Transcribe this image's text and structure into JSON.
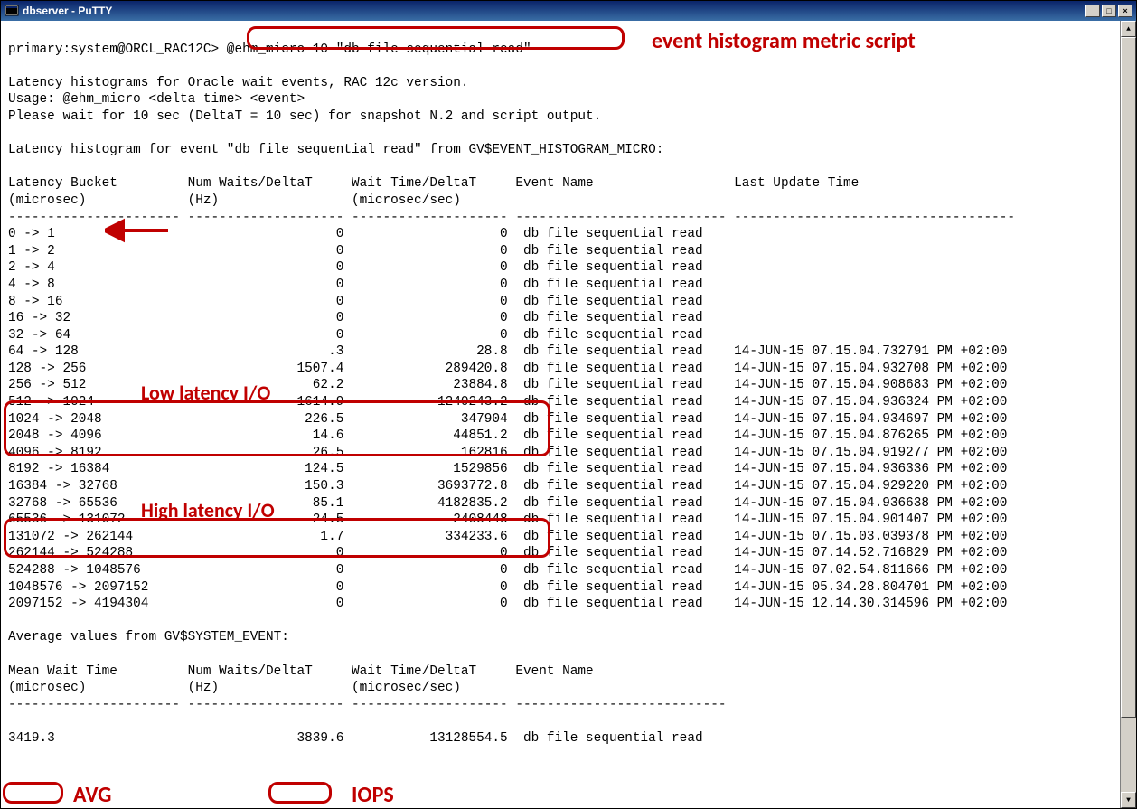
{
  "window": {
    "title": "dbserver - PuTTY",
    "icon_name": "terminal-icon"
  },
  "prompt": {
    "text": "primary:system@ORCL_RAC12C>",
    "command": "@ehm_micro 10 \"db file sequential read\""
  },
  "intro": {
    "line1": "Latency histograms for Oracle wait events, RAC 12c version.",
    "line2": "Usage: @ehm_micro <delta time> <event>",
    "line3": "Please wait for 10 sec (DeltaT = 10 sec) for snapshot N.2 and script output.",
    "line4": "Latency histogram for event \"db file sequential read\" from GV$EVENT_HISTOGRAM_MICRO:"
  },
  "columns": {
    "c1a": "Latency Bucket",
    "c1b": "(microsec)",
    "c2a": "Num Waits/DeltaT",
    "c2b": "(Hz)",
    "c3a": "Wait Time/DeltaT",
    "c3b": "(microsec/sec)",
    "c4": "Event Name",
    "c5": "Last Update Time"
  },
  "rows": [
    {
      "bucket": "0 -> 1",
      "waits": "0",
      "wt": "0",
      "evt": "db file sequential read",
      "ts": ""
    },
    {
      "bucket": "1 -> 2",
      "waits": "0",
      "wt": "0",
      "evt": "db file sequential read",
      "ts": ""
    },
    {
      "bucket": "2 -> 4",
      "waits": "0",
      "wt": "0",
      "evt": "db file sequential read",
      "ts": ""
    },
    {
      "bucket": "4 -> 8",
      "waits": "0",
      "wt": "0",
      "evt": "db file sequential read",
      "ts": ""
    },
    {
      "bucket": "8 -> 16",
      "waits": "0",
      "wt": "0",
      "evt": "db file sequential read",
      "ts": ""
    },
    {
      "bucket": "16 -> 32",
      "waits": "0",
      "wt": "0",
      "evt": "db file sequential read",
      "ts": ""
    },
    {
      "bucket": "32 -> 64",
      "waits": "0",
      "wt": "0",
      "evt": "db file sequential read",
      "ts": ""
    },
    {
      "bucket": "64 -> 128",
      "waits": ".3",
      "wt": "28.8",
      "evt": "db file sequential read",
      "ts": "14-JUN-15 07.15.04.732791 PM +02:00"
    },
    {
      "bucket": "128 -> 256",
      "waits": "1507.4",
      "wt": "289420.8",
      "evt": "db file sequential read",
      "ts": "14-JUN-15 07.15.04.932708 PM +02:00"
    },
    {
      "bucket": "256 -> 512",
      "waits": "62.2",
      "wt": "23884.8",
      "evt": "db file sequential read",
      "ts": "14-JUN-15 07.15.04.908683 PM +02:00"
    },
    {
      "bucket": "512 -> 1024",
      "waits": "1614.9",
      "wt": "1240243.2",
      "evt": "db file sequential read",
      "ts": "14-JUN-15 07.15.04.936324 PM +02:00"
    },
    {
      "bucket": "1024 -> 2048",
      "waits": "226.5",
      "wt": "347904",
      "evt": "db file sequential read",
      "ts": "14-JUN-15 07.15.04.934697 PM +02:00"
    },
    {
      "bucket": "2048 -> 4096",
      "waits": "14.6",
      "wt": "44851.2",
      "evt": "db file sequential read",
      "ts": "14-JUN-15 07.15.04.876265 PM +02:00"
    },
    {
      "bucket": "4096 -> 8192",
      "waits": "26.5",
      "wt": "162816",
      "evt": "db file sequential read",
      "ts": "14-JUN-15 07.15.04.919277 PM +02:00"
    },
    {
      "bucket": "8192 -> 16384",
      "waits": "124.5",
      "wt": "1529856",
      "evt": "db file sequential read",
      "ts": "14-JUN-15 07.15.04.936336 PM +02:00"
    },
    {
      "bucket": "16384 -> 32768",
      "waits": "150.3",
      "wt": "3693772.8",
      "evt": "db file sequential read",
      "ts": "14-JUN-15 07.15.04.929220 PM +02:00"
    },
    {
      "bucket": "32768 -> 65536",
      "waits": "85.1",
      "wt": "4182835.2",
      "evt": "db file sequential read",
      "ts": "14-JUN-15 07.15.04.936638 PM +02:00"
    },
    {
      "bucket": "65536 -> 131072",
      "waits": "24.5",
      "wt": "2408448",
      "evt": "db file sequential read",
      "ts": "14-JUN-15 07.15.04.901407 PM +02:00"
    },
    {
      "bucket": "131072 -> 262144",
      "waits": "1.7",
      "wt": "334233.6",
      "evt": "db file sequential read",
      "ts": "14-JUN-15 07.15.03.039378 PM +02:00"
    },
    {
      "bucket": "262144 -> 524288",
      "waits": "0",
      "wt": "0",
      "evt": "db file sequential read",
      "ts": "14-JUN-15 07.14.52.716829 PM +02:00"
    },
    {
      "bucket": "524288 -> 1048576",
      "waits": "0",
      "wt": "0",
      "evt": "db file sequential read",
      "ts": "14-JUN-15 07.02.54.811666 PM +02:00"
    },
    {
      "bucket": "1048576 -> 2097152",
      "waits": "0",
      "wt": "0",
      "evt": "db file sequential read",
      "ts": "14-JUN-15 05.34.28.804701 PM +02:00"
    },
    {
      "bucket": "2097152 -> 4194304",
      "waits": "0",
      "wt": "0",
      "evt": "db file sequential read",
      "ts": "14-JUN-15 12.14.30.314596 PM +02:00"
    }
  ],
  "summary": {
    "heading": "Average values from GV$SYSTEM_EVENT:",
    "h1a": "Mean Wait Time",
    "h1b": "(microsec)",
    "h2a": "Num Waits/DeltaT",
    "h2b": "(Hz)",
    "h3a": "Wait Time/DeltaT",
    "h3b": "(microsec/sec)",
    "h4": "Event Name",
    "mean": "3419.3",
    "waits": "3839.6",
    "wt": "13128554.5",
    "evt": "db file sequential read"
  },
  "annotations": {
    "script_label": "event histogram metric script",
    "low_latency": "Low latency I/O",
    "high_latency": "High latency I/O",
    "avg": "AVG",
    "iops": "IOPS"
  }
}
